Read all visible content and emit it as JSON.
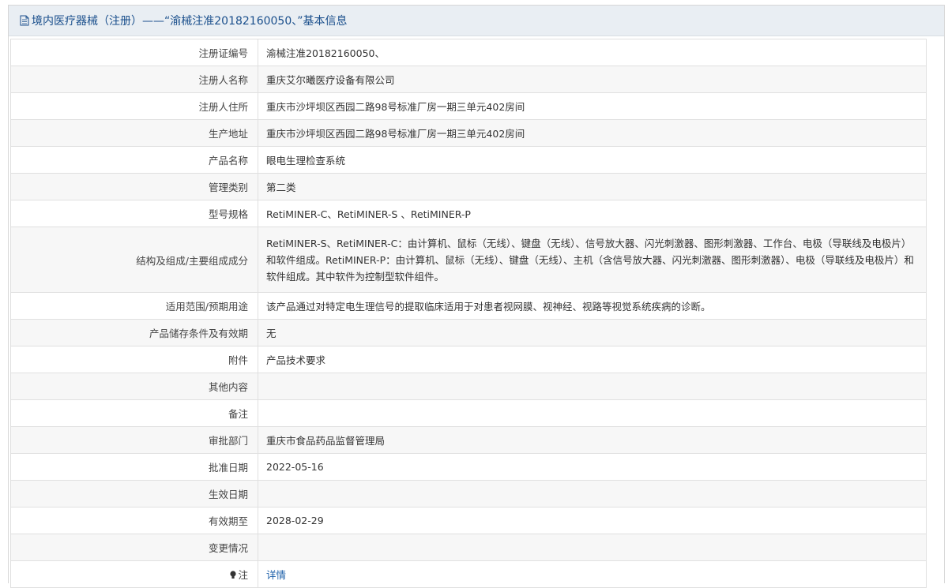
{
  "header": {
    "title": "境内医疗器械（注册）——“渝械注准20182160050、”基本信息"
  },
  "rows": [
    {
      "label": "注册证编号",
      "value": "渝械注准20182160050、"
    },
    {
      "label": "注册人名称",
      "value": "重庆艾尔曦医疗设备有限公司"
    },
    {
      "label": "注册人住所",
      "value": "重庆市沙坪坝区西园二路98号标准厂房一期三单元402房间"
    },
    {
      "label": "生产地址",
      "value": "重庆市沙坪坝区西园二路98号标准厂房一期三单元402房间"
    },
    {
      "label": "产品名称",
      "value": "眼电生理检查系统"
    },
    {
      "label": "管理类别",
      "value": "第二类"
    },
    {
      "label": "型号规格",
      "value": "RetiMINER-C、RetiMINER-S 、RetiMINER-P"
    },
    {
      "label": "结构及组成/主要组成成分",
      "value": "RetiMINER-S、RetiMINER-C：由计算机、鼠标（无线）、键盘（无线）、信号放大器、闪光刺激器、图形刺激器、工作台、电极（导联线及电极片）和软件组成。RetiMINER-P：由计算机、鼠标（无线）、键盘（无线）、主机（含信号放大器、闪光刺激器、图形刺激器）、电极（导联线及电极片）和软件组成。其中软件为控制型软件组件。"
    },
    {
      "label": "适用范围/预期用途",
      "value": "该产品通过对特定电生理信号的提取临床适用于对患者视网膜、视神经、视路等视觉系统疾病的诊断。"
    },
    {
      "label": "产品储存条件及有效期",
      "value": "无"
    },
    {
      "label": "附件",
      "value": "产品技术要求"
    },
    {
      "label": "其他内容",
      "value": ""
    },
    {
      "label": "备注",
      "value": ""
    },
    {
      "label": "审批部门",
      "value": "重庆市食品药品监督管理局"
    },
    {
      "label": "批准日期",
      "value": "2022-05-16"
    },
    {
      "label": "生效日期",
      "value": ""
    },
    {
      "label": "有效期至",
      "value": "2028-02-29"
    },
    {
      "label": "变更情况",
      "value": ""
    }
  ],
  "note": {
    "label": "注",
    "link_text": "详情",
    "icon": "bulb-icon"
  },
  "colors": {
    "header_bg": "#e9eef3",
    "title": "#1a4f8c",
    "link": "#1a5ea8",
    "row_alt": "#f7f7f7"
  }
}
